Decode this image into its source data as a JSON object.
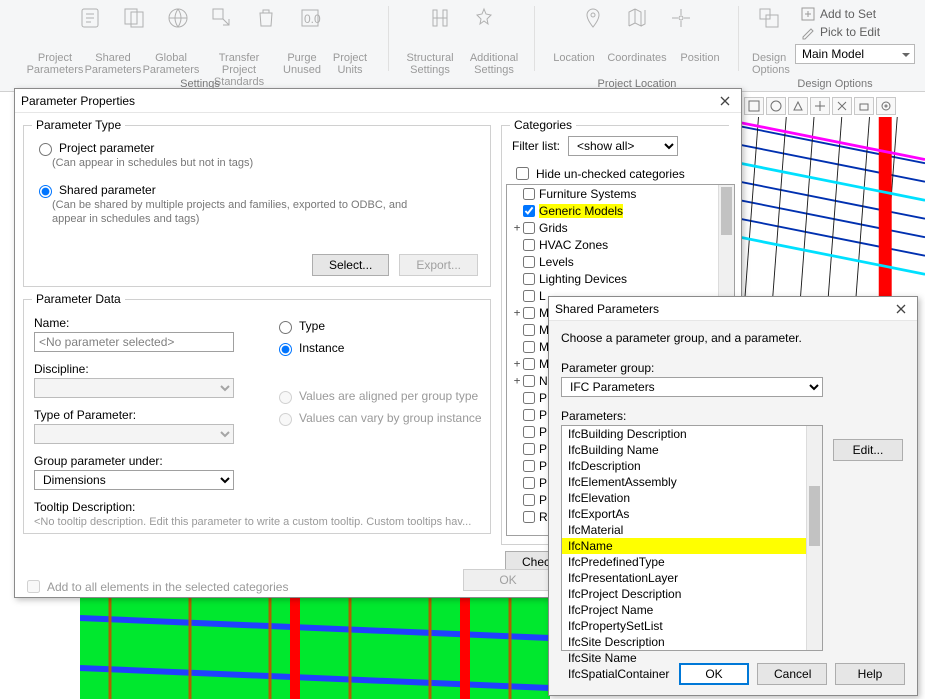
{
  "ribbon": {
    "groups": {
      "settings": {
        "title": "Settings",
        "items": [
          "Project\nParameters",
          "Shared\nParameters",
          "Global\nParameters",
          "Transfer\nProject Standards",
          "Purge\nUnused",
          "Project\nUnits"
        ]
      },
      "settings2": {
        "items": [
          "Structural\nSettings",
          "Additional\nSettings"
        ]
      },
      "projloc": {
        "title": "Project Location",
        "items": [
          "Location",
          "Coordinates",
          "Position"
        ]
      },
      "designopts": {
        "title": "Design Options",
        "big": "Design\nOptions",
        "add_to_set": "Add to Set",
        "pick_to_edit": "Pick to Edit",
        "main_model": "Main Model"
      }
    }
  },
  "param_props": {
    "title": "Parameter Properties",
    "param_type": {
      "legend": "Parameter Type",
      "project": {
        "label": "Project parameter",
        "hint": "(Can appear in schedules but not in tags)"
      },
      "shared": {
        "label": "Shared parameter",
        "hint": "(Can be shared by multiple projects and families, exported to ODBC, and appear in schedules and tags)"
      },
      "select": "Select...",
      "export": "Export..."
    },
    "param_data": {
      "legend": "Parameter Data",
      "name_label": "Name:",
      "name_value": "<No parameter selected>",
      "discipline_label": "Discipline:",
      "type_of_param_label": "Type of Parameter:",
      "group_label": "Group parameter under:",
      "group_value": "Dimensions",
      "tooltip_label": "Tooltip Description:",
      "tooltip_hint": "<No tooltip description. Edit this parameter to write a custom tooltip. Custom tooltips hav...",
      "type_radio": "Type",
      "instance_radio": "Instance",
      "values_aligned": "Values are aligned per group type",
      "values_vary": "Values can vary by group instance"
    },
    "add_all": "Add to all elements in the selected categories",
    "buttons": {
      "ok": "OK",
      "check_btn": "Chec"
    },
    "categories": {
      "legend": "Categories",
      "filter_label": "Filter list:",
      "filter_value": "<show all>",
      "hide_unchecked": "Hide un-checked categories",
      "items": [
        {
          "label": "Furniture Systems",
          "exp": "",
          "chk": false
        },
        {
          "label": "Generic Models",
          "exp": "",
          "chk": true,
          "hl": true
        },
        {
          "label": "Grids",
          "exp": "+",
          "chk": false
        },
        {
          "label": "HVAC Zones",
          "exp": "",
          "chk": false
        },
        {
          "label": "Levels",
          "exp": "",
          "chk": false
        },
        {
          "label": "Lighting Devices",
          "exp": "",
          "chk": false
        },
        {
          "label": "L",
          "exp": "",
          "chk": false
        },
        {
          "label": "M",
          "exp": "+",
          "chk": false
        },
        {
          "label": "M",
          "exp": "",
          "chk": false
        },
        {
          "label": "M",
          "exp": "",
          "chk": false
        },
        {
          "label": "M",
          "exp": "+",
          "chk": false
        },
        {
          "label": "N",
          "exp": "+",
          "chk": false
        },
        {
          "label": "P",
          "exp": "",
          "chk": false
        },
        {
          "label": "P",
          "exp": "",
          "chk": false
        },
        {
          "label": "P",
          "exp": "",
          "chk": false
        },
        {
          "label": "P",
          "exp": "",
          "chk": false
        },
        {
          "label": "P",
          "exp": "",
          "chk": false
        },
        {
          "label": "P",
          "exp": "",
          "chk": false
        },
        {
          "label": "P",
          "exp": "",
          "chk": false
        },
        {
          "label": "R",
          "exp": "",
          "chk": false
        }
      ]
    }
  },
  "shared_params": {
    "title": "Shared Parameters",
    "intro": "Choose a parameter group, and a parameter.",
    "group_label": "Parameter group:",
    "group_value": "IFC Parameters",
    "params_label": "Parameters:",
    "edit": "Edit...",
    "ok": "OK",
    "cancel": "Cancel",
    "help": "Help",
    "items": [
      "IfcBuilding Description",
      "IfcBuilding Name",
      "IfcDescription",
      "IfcElementAssembly",
      "IfcElevation",
      "IfcExportAs",
      "IfcMaterial",
      "IfcName",
      "IfcPredefinedType",
      "IfcPresentationLayer",
      "IfcProject Description",
      "IfcProject Name",
      "IfcPropertySetList",
      "IfcSite Description",
      "IfcSite Name",
      "IfcSpatialContainer"
    ],
    "highlight": "IfcName"
  }
}
